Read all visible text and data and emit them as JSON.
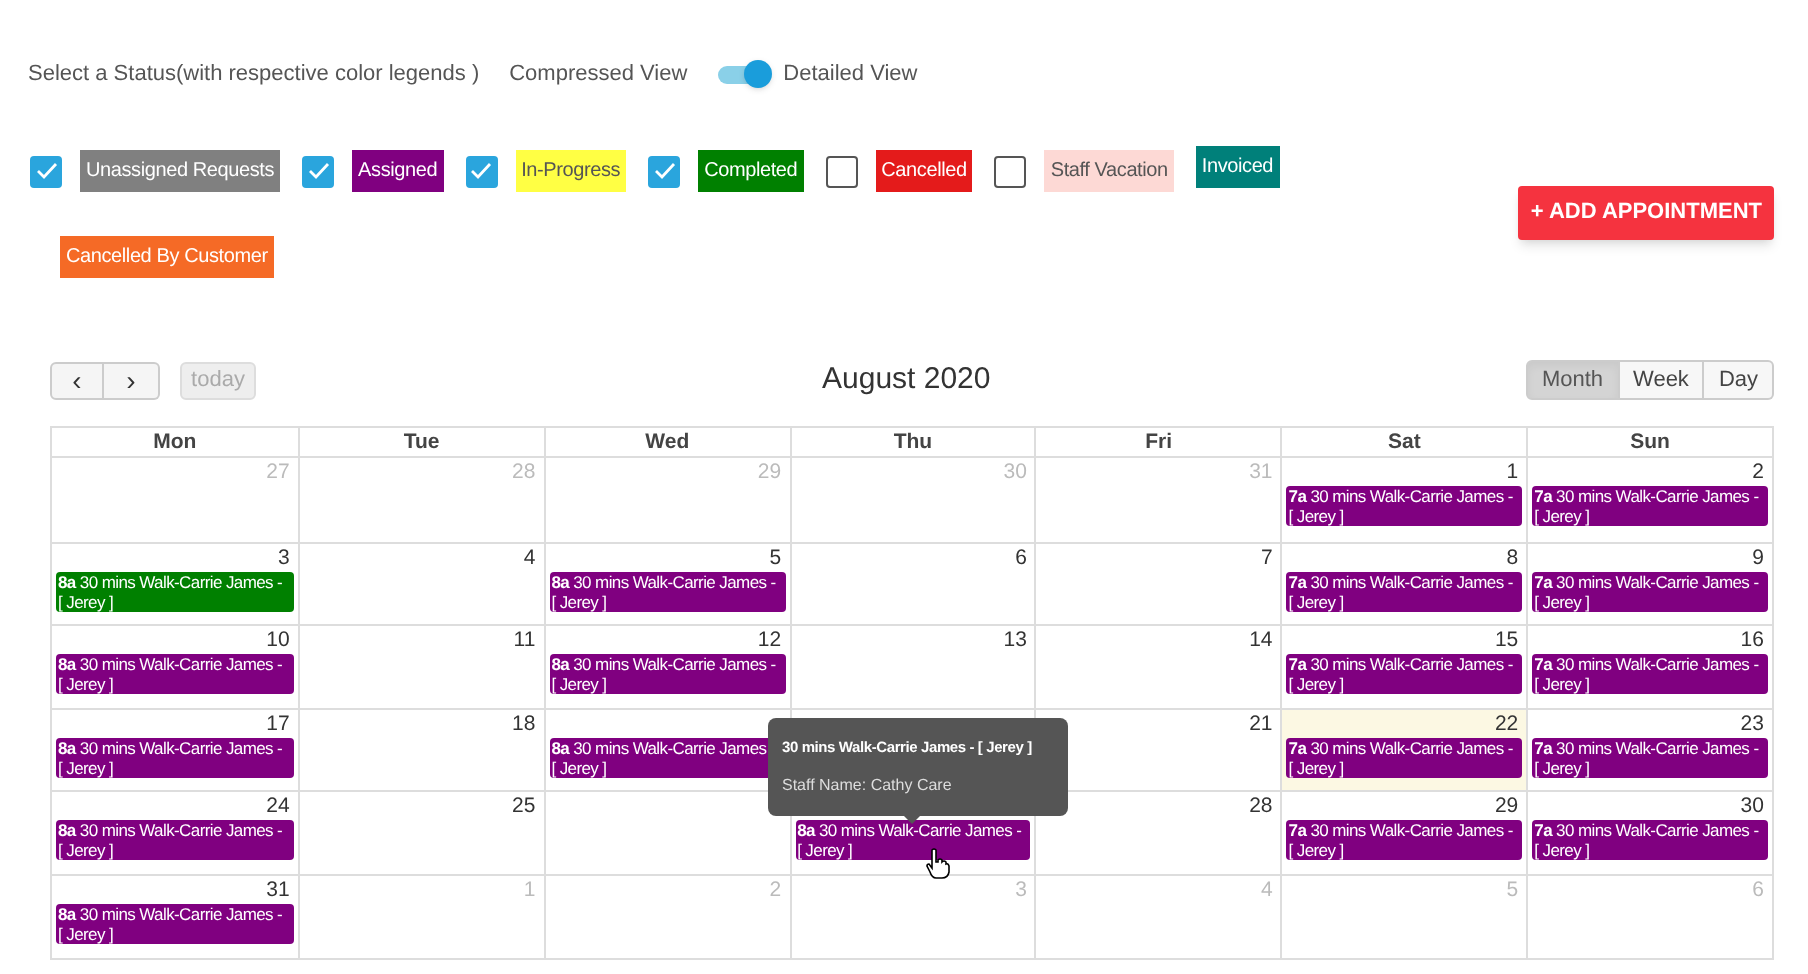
{
  "header": {
    "prompt": "Select a Status(with respective color legends )",
    "compressed_label": "Compressed View",
    "detailed_label": "Detailed View",
    "detailed_on": true
  },
  "legend": [
    {
      "kind": "checkbox",
      "checked": true,
      "label": "Unassigned Requests",
      "color": "#808080"
    },
    {
      "kind": "checkbox",
      "checked": true,
      "label": "Assigned",
      "color": "#800080"
    },
    {
      "kind": "checkbox",
      "checked": true,
      "label": "In-Progress",
      "color": "#ffff44"
    },
    {
      "kind": "checkbox",
      "checked": true,
      "label": "Completed",
      "color": "#008000"
    },
    {
      "kind": "checkbox",
      "checked": false,
      "label": "Cancelled",
      "color": "#e41b1b"
    },
    {
      "kind": "checkbox",
      "checked": false,
      "label": "Staff Vacation",
      "color": "#fdd9d5"
    },
    {
      "kind": "plain",
      "label": "Invoiced",
      "color": "#00807a"
    },
    {
      "kind": "plain",
      "label": "Cancelled By Customer",
      "color": "#f56a26"
    }
  ],
  "add_button": "+ ADD APPOINTMENT",
  "toolbar": {
    "prev": "‹",
    "next": "›",
    "today": "today",
    "title": "August 2020",
    "views": [
      {
        "label": "Month",
        "selected": true
      },
      {
        "label": "Week",
        "selected": false
      },
      {
        "label": "Day",
        "selected": false
      }
    ]
  },
  "calendar": {
    "weekdays": [
      "Mon",
      "Tue",
      "Wed",
      "Thu",
      "Fri",
      "Sat",
      "Sun"
    ],
    "weeks": [
      [
        {
          "day": "27",
          "other_month": true
        },
        {
          "day": "28",
          "other_month": true
        },
        {
          "day": "29",
          "other_month": true
        },
        {
          "day": "30",
          "other_month": true
        },
        {
          "day": "31",
          "other_month": true
        },
        {
          "day": "1",
          "other_month": false,
          "events": [
            {
              "time": "7a",
              "title": "30 mins Walk-Carrie James -",
              "detail": "[ Jerey ]",
              "color": "#800080"
            }
          ]
        },
        {
          "day": "2",
          "other_month": false,
          "events": [
            {
              "time": "7a",
              "title": "30 mins Walk-Carrie James -",
              "detail": "[ Jerey ]",
              "color": "#800080"
            }
          ]
        }
      ],
      [
        {
          "day": "3",
          "other_month": false,
          "events": [
            {
              "time": "8a",
              "title": "30 mins Walk-Carrie James -",
              "detail": "[ Jerey ]",
              "color": "#008000"
            }
          ]
        },
        {
          "day": "4",
          "other_month": false
        },
        {
          "day": "5",
          "other_month": false,
          "events": [
            {
              "time": "8a",
              "title": "30 mins Walk-Carrie James -",
              "detail": "[ Jerey ]",
              "color": "#800080"
            }
          ]
        },
        {
          "day": "6",
          "other_month": false
        },
        {
          "day": "7",
          "other_month": false
        },
        {
          "day": "8",
          "other_month": false,
          "events": [
            {
              "time": "7a",
              "title": "30 mins Walk-Carrie James -",
              "detail": "[ Jerey ]",
              "color": "#800080"
            }
          ]
        },
        {
          "day": "9",
          "other_month": false,
          "events": [
            {
              "time": "7a",
              "title": "30 mins Walk-Carrie James -",
              "detail": "[ Jerey ]",
              "color": "#800080"
            }
          ]
        }
      ],
      [
        {
          "day": "10",
          "other_month": false,
          "events": [
            {
              "time": "8a",
              "title": "30 mins Walk-Carrie James -",
              "detail": "[ Jerey ]",
              "color": "#800080"
            }
          ]
        },
        {
          "day": "11",
          "other_month": false
        },
        {
          "day": "12",
          "other_month": false,
          "events": [
            {
              "time": "8a",
              "title": "30 mins Walk-Carrie James -",
              "detail": "[ Jerey ]",
              "color": "#800080"
            }
          ]
        },
        {
          "day": "13",
          "other_month": false
        },
        {
          "day": "14",
          "other_month": false
        },
        {
          "day": "15",
          "other_month": false,
          "events": [
            {
              "time": "7a",
              "title": "30 mins Walk-Carrie James -",
              "detail": "[ Jerey ]",
              "color": "#800080"
            }
          ]
        },
        {
          "day": "16",
          "other_month": false,
          "events": [
            {
              "time": "7a",
              "title": "30 mins Walk-Carrie James -",
              "detail": "[ Jerey ]",
              "color": "#800080"
            }
          ]
        }
      ],
      [
        {
          "day": "17",
          "other_month": false,
          "events": [
            {
              "time": "8a",
              "title": "30 mins Walk-Carrie James -",
              "detail": "[ Jerey ]",
              "color": "#800080"
            }
          ]
        },
        {
          "day": "18",
          "other_month": false
        },
        {
          "events": [
            {
              "time": "8a",
              "title": "30 mins Walk-Carrie James",
              "detail": "[ Jerey ]",
              "color": "#800080"
            }
          ]
        },
        {
          "kind": "covered"
        },
        {
          "day": "21",
          "other_month": false
        },
        {
          "day": "22",
          "other_month": false,
          "today": true,
          "events": [
            {
              "time": "7a",
              "title": "30 mins Walk-Carrie James -",
              "detail": "[ Jerey ]",
              "color": "#800080"
            }
          ]
        },
        {
          "day": "23",
          "other_month": false,
          "events": [
            {
              "time": "7a",
              "title": "30 mins Walk-Carrie James -",
              "detail": "[ Jerey ]",
              "color": "#800080"
            }
          ]
        }
      ],
      [
        {
          "day": "24",
          "other_month": false,
          "events": [
            {
              "time": "8a",
              "title": "30 mins Walk-Carrie James -",
              "detail": "[ Jerey ]",
              "color": "#800080"
            }
          ]
        },
        {
          "day": "25",
          "other_month": false
        },
        {
          "kind": "covered"
        },
        {
          "events": [
            {
              "time": "8a",
              "title": "30 mins Walk-Carrie James -",
              "detail": "[ Jerey ]",
              "color": "#800080"
            }
          ]
        },
        {
          "day": "28",
          "other_month": false
        },
        {
          "day": "29",
          "other_month": false,
          "events": [
            {
              "time": "7a",
              "title": "30 mins Walk-Carrie James -",
              "detail": "[ Jerey ]",
              "color": "#800080"
            }
          ]
        },
        {
          "day": "30",
          "other_month": false,
          "events": [
            {
              "time": "7a",
              "title": "30 mins Walk-Carrie James -",
              "detail": "[ Jerey ]",
              "color": "#800080"
            }
          ]
        }
      ],
      [
        {
          "day": "31",
          "other_month": false,
          "events": [
            {
              "time": "8a",
              "title": "30 mins Walk-Carrie James -",
              "detail": "[ Jerey ]",
              "color": "#800080"
            }
          ]
        },
        {
          "day": "1",
          "other_month": true
        },
        {
          "day": "2",
          "other_month": true
        },
        {
          "day": "3",
          "other_month": true
        },
        {
          "day": "4",
          "other_month": true
        },
        {
          "day": "5",
          "other_month": true
        },
        {
          "day": "6",
          "other_month": true
        }
      ]
    ]
  },
  "tooltip": {
    "title": "30 mins Walk-Carrie James - [ Jerey ]",
    "staff": "Staff Name: Cathy Care"
  }
}
